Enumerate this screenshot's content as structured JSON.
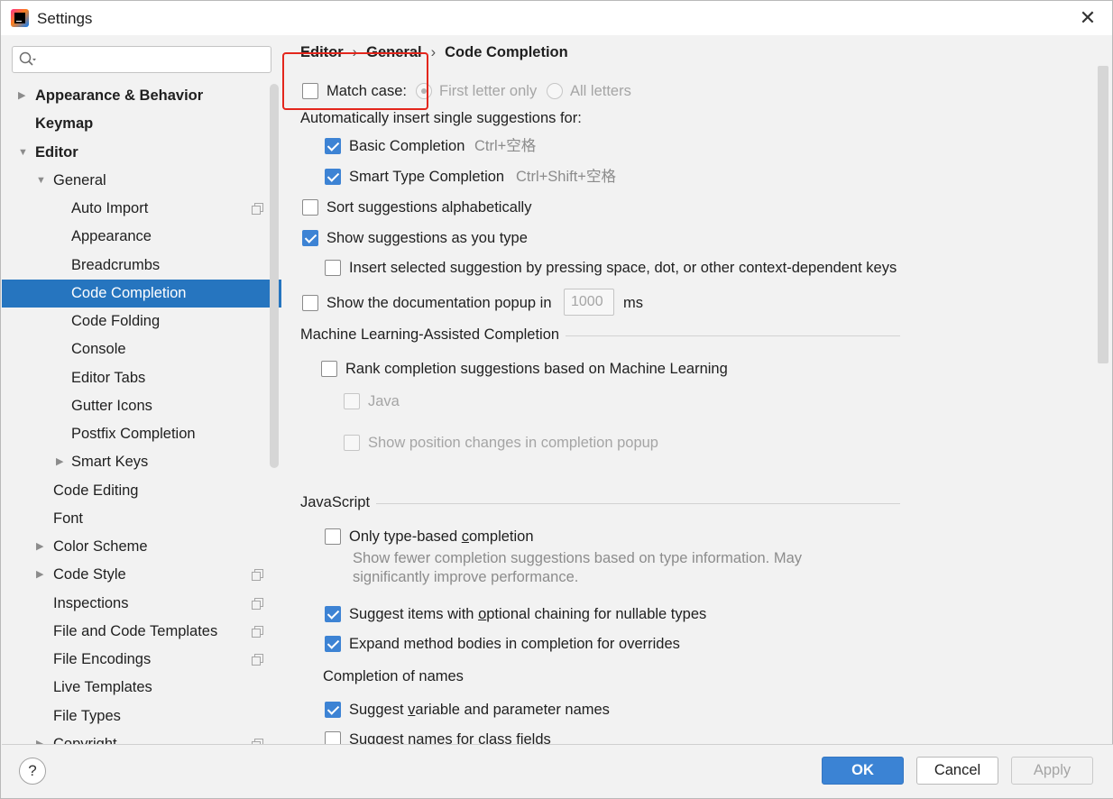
{
  "window": {
    "title": "Settings",
    "close_glyph": "✕"
  },
  "sidebar": {
    "search_placeholder": "",
    "items": [
      {
        "label": "Appearance & Behavior",
        "bold": true,
        "arrow": "▶",
        "level": 0
      },
      {
        "label": "Keymap",
        "bold": true,
        "arrow": "",
        "level": 0
      },
      {
        "label": "Editor",
        "bold": true,
        "arrow": "▼",
        "level": 0
      },
      {
        "label": "General",
        "arrow": "▼",
        "level": 1
      },
      {
        "label": "Auto Import",
        "level": 2,
        "copy_icon": true
      },
      {
        "label": "Appearance",
        "level": 2
      },
      {
        "label": "Breadcrumbs",
        "level": 2
      },
      {
        "label": "Code Completion",
        "level": 2,
        "selected": true
      },
      {
        "label": "Code Folding",
        "level": 2
      },
      {
        "label": "Console",
        "level": 2
      },
      {
        "label": "Editor Tabs",
        "level": 2
      },
      {
        "label": "Gutter Icons",
        "level": 2
      },
      {
        "label": "Postfix Completion",
        "level": 2
      },
      {
        "label": "Smart Keys",
        "arrow": "▶",
        "level": 2
      },
      {
        "label": "Code Editing",
        "level": 1
      },
      {
        "label": "Font",
        "level": 1
      },
      {
        "label": "Color Scheme",
        "arrow": "▶",
        "level": 1
      },
      {
        "label": "Code Style",
        "arrow": "▶",
        "level": 1,
        "copy_icon": true
      },
      {
        "label": "Inspections",
        "level": 1,
        "copy_icon": true
      },
      {
        "label": "File and Code Templates",
        "level": 1,
        "copy_icon": true
      },
      {
        "label": "File Encodings",
        "level": 1,
        "copy_icon": true
      },
      {
        "label": "Live Templates",
        "level": 1
      },
      {
        "label": "File Types",
        "level": 1
      },
      {
        "label": "Copyright",
        "arrow": "▶",
        "level": 1,
        "copy_icon": true
      }
    ]
  },
  "breadcrumb": {
    "items": [
      "Editor",
      "General",
      "Code Completion"
    ],
    "separator": "›"
  },
  "match_case": {
    "label": "Match case:",
    "checked": false,
    "options": [
      {
        "label": "First letter only",
        "selected": true
      },
      {
        "label": "All letters",
        "selected": false
      }
    ]
  },
  "auto_insert": {
    "label": "Automatically insert single suggestions for:",
    "basic": {
      "label": "Basic Completion",
      "shortcut": "Ctrl+空格",
      "checked": true
    },
    "smart": {
      "label": "Smart Type Completion",
      "shortcut": "Ctrl+Shift+空格",
      "checked": true
    }
  },
  "sort_alpha": {
    "label": "Sort suggestions alphabetically",
    "checked": false
  },
  "show_as_type": {
    "label": "Show suggestions as you type",
    "checked": true
  },
  "insert_selected": {
    "label": "Insert selected suggestion by pressing space, dot, or other context-dependent keys",
    "checked": false
  },
  "doc_popup": {
    "label": "Show the documentation popup in",
    "value": "1000",
    "unit": "ms",
    "checked": false
  },
  "ml": {
    "title": "Machine Learning-Assisted Completion",
    "rank": {
      "label": "Rank completion suggestions based on Machine Learning",
      "checked": false
    },
    "java": {
      "label": "Java",
      "checked": false
    },
    "position": {
      "label": "Show position changes in completion popup",
      "checked": false
    }
  },
  "javascript": {
    "title": "JavaScript",
    "type_based": {
      "label_pre": "Only type-based ",
      "label_u": "c",
      "label_post": "ompletion",
      "checked": false
    },
    "type_based_desc_1": "Show fewer completion suggestions based on type information. May",
    "type_based_desc_2": "significantly improve performance.",
    "optional_chaining": {
      "label_pre": "Suggest items with ",
      "label_u": "o",
      "label_post": "ptional chaining for nullable types",
      "checked": true
    },
    "expand_bodies": {
      "label": "Expand method bodies in completion for overrides",
      "checked": true
    },
    "names_title": "Completion of names",
    "var_names": {
      "label_pre": "Suggest ",
      "label_u": "v",
      "label_post": "ariable and parameter names",
      "checked": true
    },
    "class_fields": {
      "label": "Suggest names for class fields",
      "checked": false
    }
  },
  "footer": {
    "help": "?",
    "ok": "OK",
    "cancel": "Cancel",
    "apply": "Apply"
  },
  "colors": {
    "selection": "#2675bf",
    "primary_button": "#3b83d4",
    "checkbox_checked": "#3d83d4",
    "highlight_box": "#e3261c"
  }
}
